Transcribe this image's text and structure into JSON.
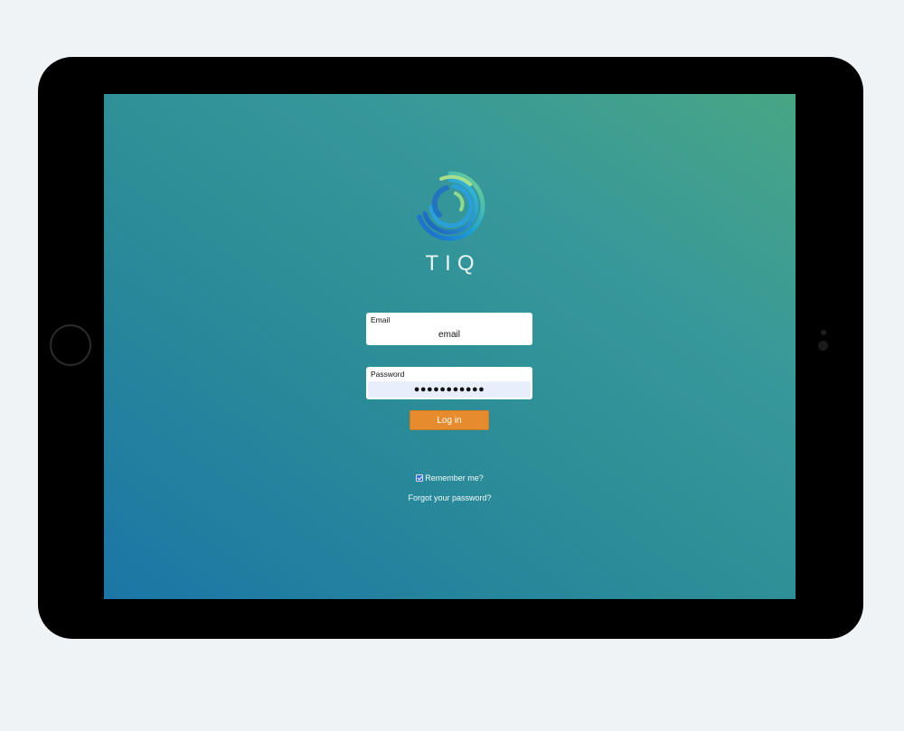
{
  "brand": {
    "name": "TIQ"
  },
  "login_form": {
    "email": {
      "label": "Email",
      "value": "email"
    },
    "password": {
      "label": "Password",
      "masked_value": "●●●●●●●●●●●"
    },
    "login_button_label": "Log in",
    "remember_me": {
      "label": "Remember me?",
      "checked": true
    },
    "forgot_password_label": "Forgot your password?"
  },
  "colors": {
    "login_button": "#e68b2e",
    "screen_gradient_start": "#1b76a6",
    "screen_gradient_end": "#48a684"
  },
  "icons": {
    "logo": "tiq-logo-icon",
    "home_button": "home-button",
    "checkbox": "checkbox-checked-icon"
  }
}
